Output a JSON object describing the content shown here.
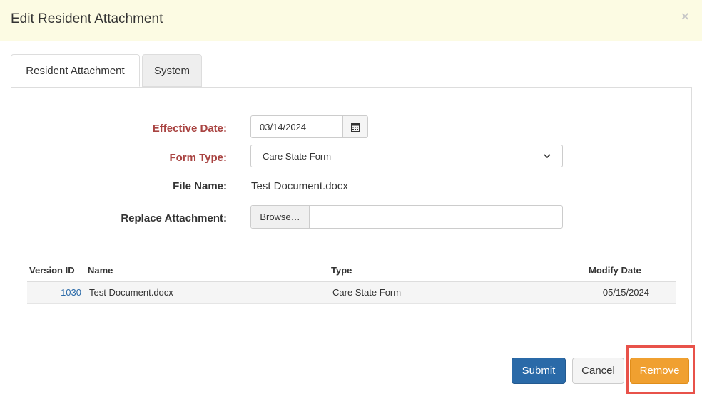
{
  "modal": {
    "title": "Edit Resident Attachment",
    "close_glyph": "×"
  },
  "tabs": [
    {
      "label": "Resident Attachment",
      "active": true
    },
    {
      "label": "System",
      "active": false
    }
  ],
  "form": {
    "effective_date": {
      "label": "Effective Date:",
      "value": "03/14/2024",
      "required": true
    },
    "form_type": {
      "label": "Form Type:",
      "value": "Care State Form",
      "required": true
    },
    "file_name": {
      "label": "File Name:",
      "value": "Test Document.docx"
    },
    "replace_attachment": {
      "label": "Replace Attachment:",
      "browse_label": "Browse…",
      "value": ""
    }
  },
  "versions_table": {
    "headers": [
      "Version ID",
      "Name",
      "Type",
      "Modify Date"
    ],
    "rows": [
      {
        "version_id": "1030",
        "name": "Test Document.docx",
        "type": "Care State Form",
        "modify_date": "05/15/2024"
      }
    ]
  },
  "footer": {
    "submit_label": "Submit",
    "cancel_label": "Cancel",
    "remove_label": "Remove"
  },
  "colors": {
    "header_bg": "#fcfbe3",
    "required_label": "#a94442",
    "submit": "#2a6aa8",
    "remove": "#f0a030",
    "highlight": "#e8524a",
    "link": "#2a6aa8"
  }
}
